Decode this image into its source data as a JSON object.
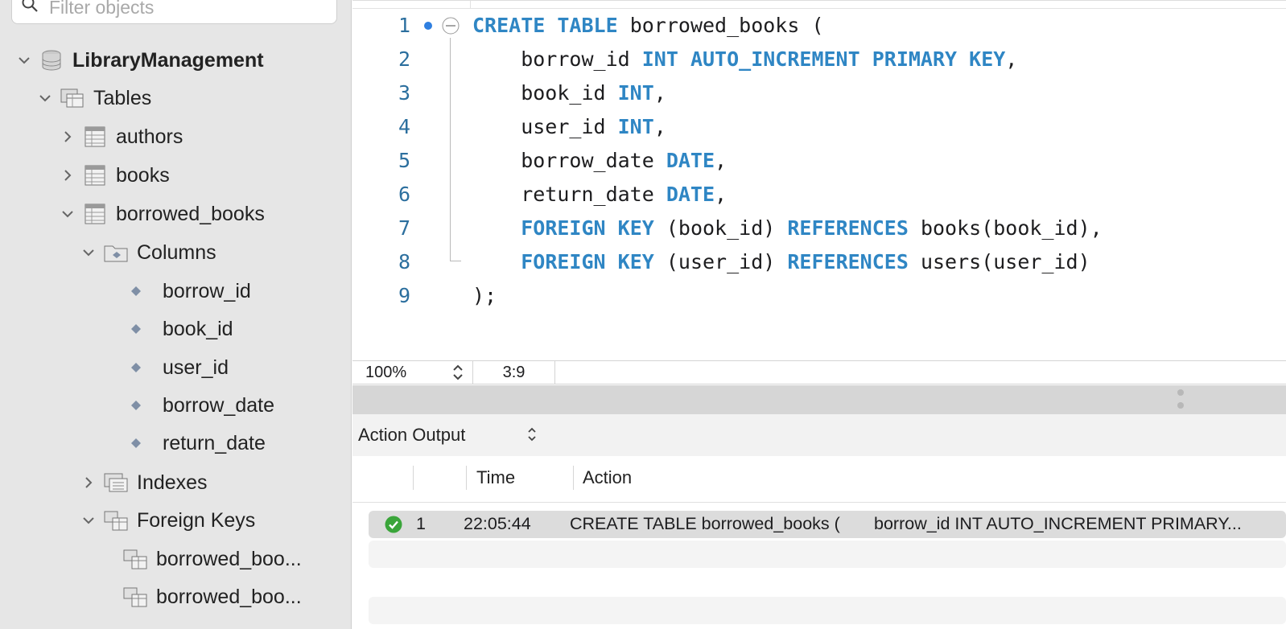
{
  "sidebar": {
    "filter_placeholder": "Filter objects",
    "schema": "LibraryManagement",
    "tables_label": "Tables",
    "tables": [
      "authors",
      "books",
      "borrowed_books"
    ],
    "columns_label": "Columns",
    "columns": [
      "borrow_id",
      "book_id",
      "user_id",
      "borrow_date",
      "return_date"
    ],
    "indexes_label": "Indexes",
    "foreign_keys_label": "Foreign Keys",
    "foreign_keys": [
      "borrowed_boo...",
      "borrowed_boo..."
    ]
  },
  "editor": {
    "line_numbers": [
      "1",
      "2",
      "3",
      "4",
      "5",
      "6",
      "7",
      "8",
      "9"
    ],
    "lines": [
      [
        {
          "t": "CREATE",
          "k": true
        },
        {
          "t": " "
        },
        {
          "t": "TABLE",
          "k": true
        },
        {
          "t": " borrowed_books ("
        }
      ],
      [
        {
          "t": "    borrow_id "
        },
        {
          "t": "INT",
          "k": true
        },
        {
          "t": " "
        },
        {
          "t": "AUTO_INCREMENT",
          "k": true
        },
        {
          "t": " "
        },
        {
          "t": "PRIMARY",
          "k": true
        },
        {
          "t": " "
        },
        {
          "t": "KEY",
          "k": true
        },
        {
          "t": ","
        }
      ],
      [
        {
          "t": "    book_id "
        },
        {
          "t": "INT",
          "k": true
        },
        {
          "t": ","
        }
      ],
      [
        {
          "t": "    user_id "
        },
        {
          "t": "INT",
          "k": true
        },
        {
          "t": ","
        }
      ],
      [
        {
          "t": "    borrow_date "
        },
        {
          "t": "DATE",
          "k": true
        },
        {
          "t": ","
        }
      ],
      [
        {
          "t": "    return_date "
        },
        {
          "t": "DATE",
          "k": true
        },
        {
          "t": ","
        }
      ],
      [
        {
          "t": "    "
        },
        {
          "t": "FOREIGN",
          "k": true
        },
        {
          "t": " "
        },
        {
          "t": "KEY",
          "k": true
        },
        {
          "t": " (book_id) "
        },
        {
          "t": "REFERENCES",
          "k": true
        },
        {
          "t": " books(book_id),"
        }
      ],
      [
        {
          "t": "    "
        },
        {
          "t": "FOREIGN",
          "k": true
        },
        {
          "t": " "
        },
        {
          "t": "KEY",
          "k": true
        },
        {
          "t": " (user_id) "
        },
        {
          "t": "REFERENCES",
          "k": true
        },
        {
          "t": " users(user_id)"
        }
      ],
      [
        {
          "t": ");"
        }
      ]
    ]
  },
  "status": {
    "zoom": "100%",
    "cursor": "3:9"
  },
  "output": {
    "title": "Action Output",
    "columns": {
      "time": "Time",
      "action": "Action"
    },
    "rows": [
      {
        "num": "1",
        "time": "22:05:44",
        "action": "CREATE TABLE borrowed_books (",
        "action_cont": "borrow_id INT AUTO_INCREMENT PRIMARY..."
      }
    ]
  },
  "colors": {
    "keyword": "#2f86c4",
    "line_number": "#2c6f9e",
    "success": "#3aa53a",
    "sidebar_bg": "#e6e6e6"
  }
}
